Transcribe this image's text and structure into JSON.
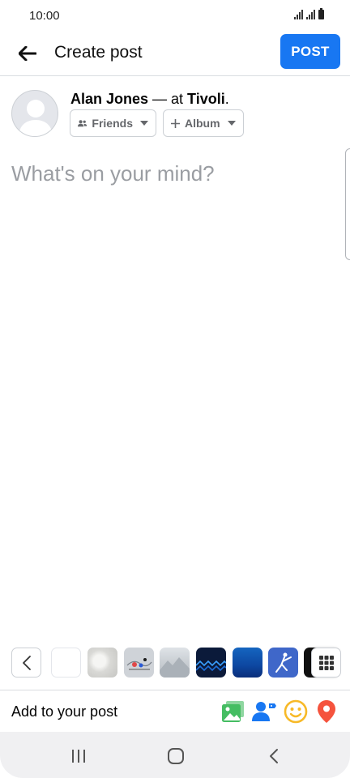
{
  "status_bar": {
    "time": "10:00"
  },
  "header": {
    "title": "Create post",
    "post_label": "POST"
  },
  "composer": {
    "author_name": "Alan Jones",
    "connector": " — at ",
    "place": "Tivoli",
    "punctuation": ".",
    "audience_label": "Friends",
    "album_label": "Album",
    "placeholder": "What's on your mind?"
  },
  "background_tray": {
    "tiles": [
      "white",
      "cotton",
      "illustration",
      "mountain",
      "blue-waves",
      "ocean",
      "dancer",
      "dark"
    ]
  },
  "add_to_post": {
    "label": "Add to your post",
    "icons": [
      "photo-icon",
      "tag-people-icon",
      "feeling-icon",
      "location-icon"
    ]
  },
  "colors": {
    "accent": "#1877f2",
    "photo": "#45bd62",
    "tag": "#1877f2",
    "feeling": "#f7b928",
    "location": "#f5533d"
  }
}
